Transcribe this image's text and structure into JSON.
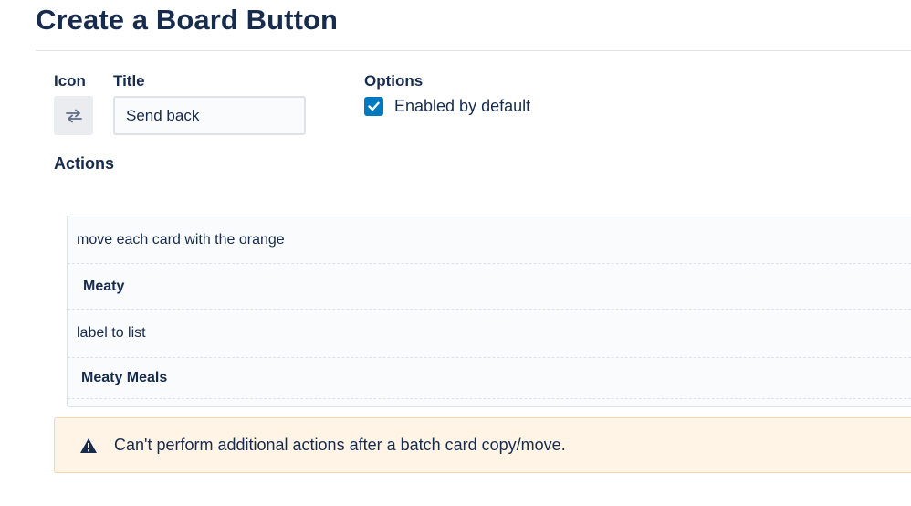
{
  "page": {
    "title": "Create a Board Button"
  },
  "form": {
    "icon_label": "Icon",
    "icon_name": "swap-arrows-icon",
    "title_label": "Title",
    "title_value": "Send back",
    "options_label": "Options",
    "enabled_checkbox": {
      "label": "Enabled by default",
      "checked": true
    }
  },
  "actions": {
    "heading": "Actions",
    "rows": [
      {
        "kind": "text",
        "text": "move each card with the orange"
      },
      {
        "kind": "chip",
        "text": "Meaty"
      },
      {
        "kind": "text",
        "text": "label to list"
      },
      {
        "kind": "chip",
        "text": "Meaty Meals"
      }
    ]
  },
  "warning": {
    "icon_name": "warning-triangle-icon",
    "text": "Can't perform additional actions after a batch card copy/move."
  },
  "colors": {
    "heading": "#172b4d",
    "checkbox_accent": "#0079bf",
    "warning_bg": "#fff4e6",
    "divider": "#dfe1e6"
  }
}
